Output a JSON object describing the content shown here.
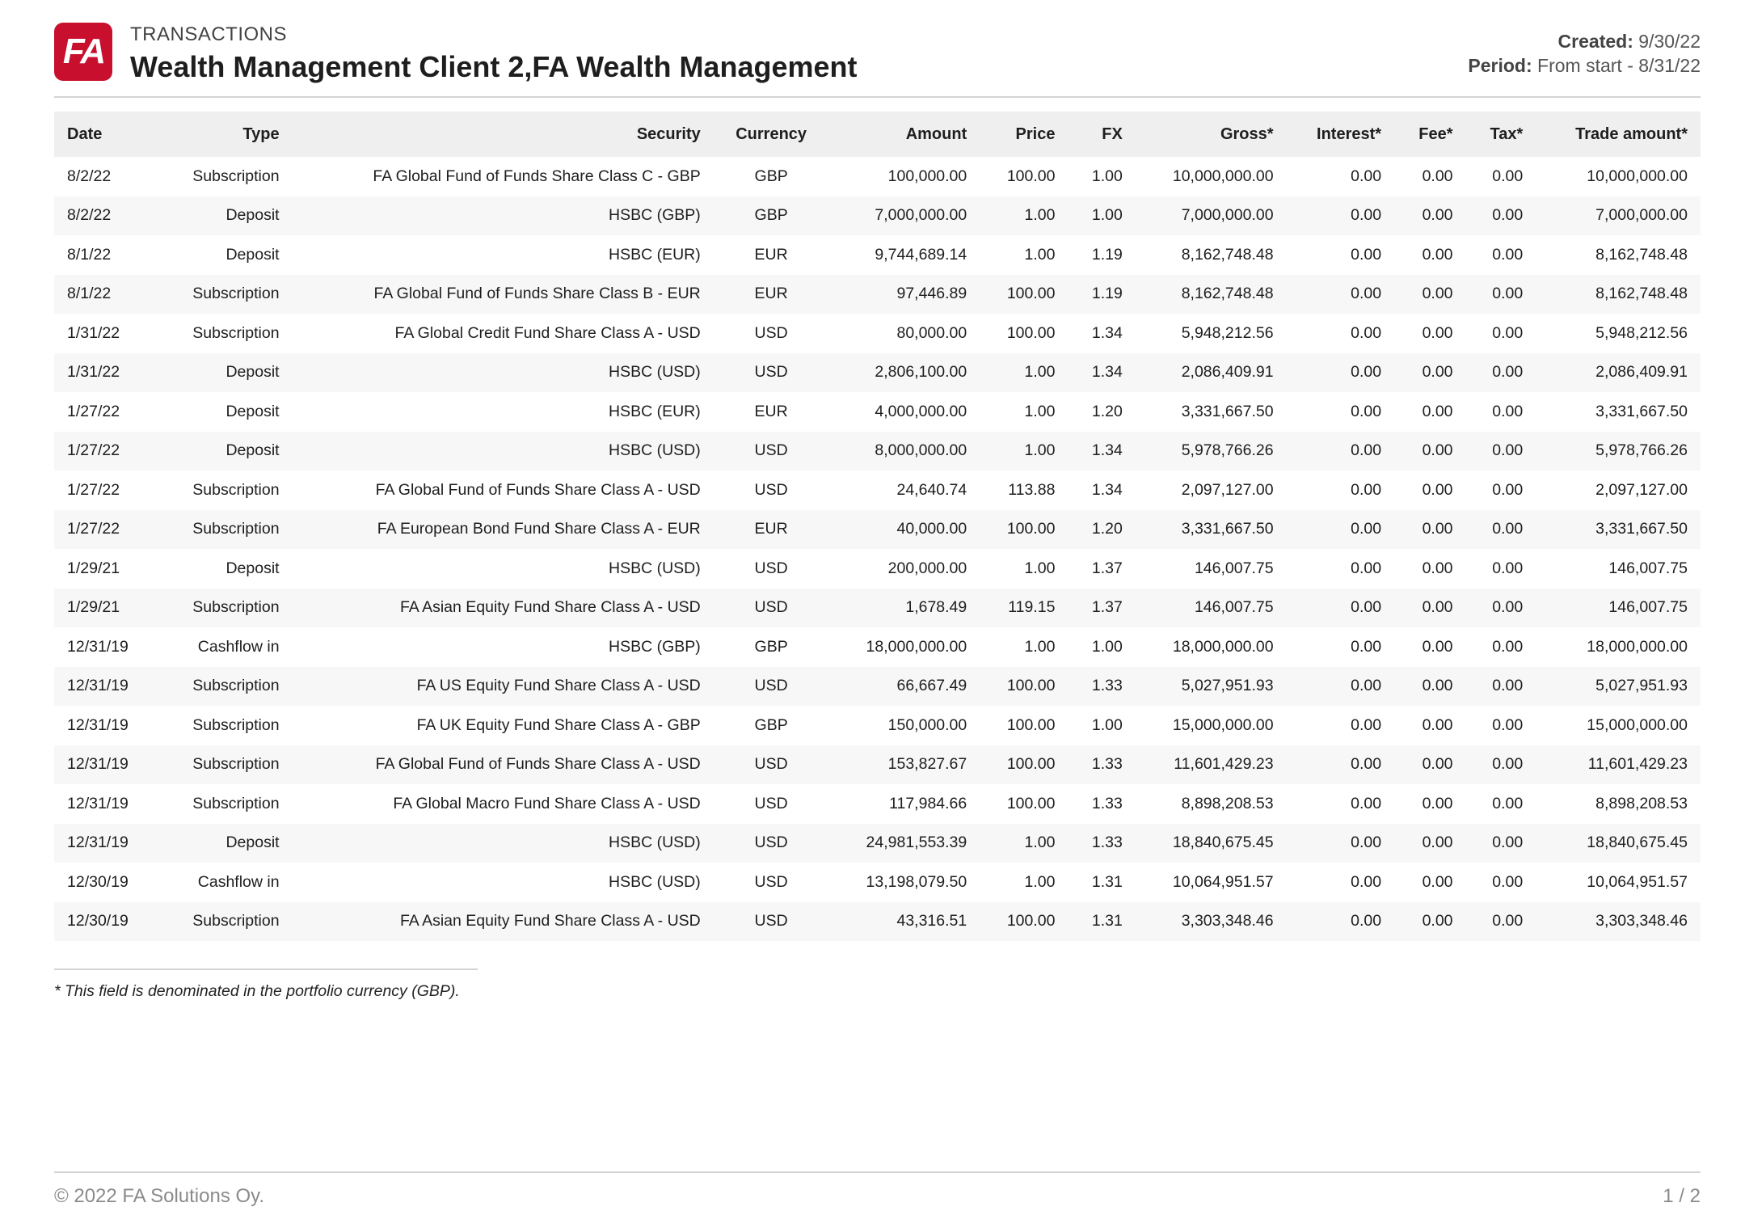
{
  "header": {
    "logo_text": "FA",
    "report_type": "TRANSACTIONS",
    "client_title": "Wealth Management Client 2,FA Wealth Management",
    "created_label": "Created:",
    "created_value": "9/30/22",
    "period_label": "Period:",
    "period_value": "From start - 8/31/22"
  },
  "table": {
    "columns": [
      "Date",
      "Type",
      "Security",
      "Currency",
      "Amount",
      "Price",
      "FX",
      "Gross*",
      "Interest*",
      "Fee*",
      "Tax*",
      "Trade amount*"
    ],
    "rows": [
      [
        "8/2/22",
        "Subscription",
        "FA Global Fund of Funds Share Class C - GBP",
        "GBP",
        "100,000.00",
        "100.00",
        "1.00",
        "10,000,000.00",
        "0.00",
        "0.00",
        "0.00",
        "10,000,000.00"
      ],
      [
        "8/2/22",
        "Deposit",
        "HSBC (GBP)",
        "GBP",
        "7,000,000.00",
        "1.00",
        "1.00",
        "7,000,000.00",
        "0.00",
        "0.00",
        "0.00",
        "7,000,000.00"
      ],
      [
        "8/1/22",
        "Deposit",
        "HSBC (EUR)",
        "EUR",
        "9,744,689.14",
        "1.00",
        "1.19",
        "8,162,748.48",
        "0.00",
        "0.00",
        "0.00",
        "8,162,748.48"
      ],
      [
        "8/1/22",
        "Subscription",
        "FA Global Fund of Funds Share Class B - EUR",
        "EUR",
        "97,446.89",
        "100.00",
        "1.19",
        "8,162,748.48",
        "0.00",
        "0.00",
        "0.00",
        "8,162,748.48"
      ],
      [
        "1/31/22",
        "Subscription",
        "FA Global Credit Fund Share Class A - USD",
        "USD",
        "80,000.00",
        "100.00",
        "1.34",
        "5,948,212.56",
        "0.00",
        "0.00",
        "0.00",
        "5,948,212.56"
      ],
      [
        "1/31/22",
        "Deposit",
        "HSBC (USD)",
        "USD",
        "2,806,100.00",
        "1.00",
        "1.34",
        "2,086,409.91",
        "0.00",
        "0.00",
        "0.00",
        "2,086,409.91"
      ],
      [
        "1/27/22",
        "Deposit",
        "HSBC (EUR)",
        "EUR",
        "4,000,000.00",
        "1.00",
        "1.20",
        "3,331,667.50",
        "0.00",
        "0.00",
        "0.00",
        "3,331,667.50"
      ],
      [
        "1/27/22",
        "Deposit",
        "HSBC (USD)",
        "USD",
        "8,000,000.00",
        "1.00",
        "1.34",
        "5,978,766.26",
        "0.00",
        "0.00",
        "0.00",
        "5,978,766.26"
      ],
      [
        "1/27/22",
        "Subscription",
        "FA Global Fund of Funds Share Class A - USD",
        "USD",
        "24,640.74",
        "113.88",
        "1.34",
        "2,097,127.00",
        "0.00",
        "0.00",
        "0.00",
        "2,097,127.00"
      ],
      [
        "1/27/22",
        "Subscription",
        "FA European Bond Fund Share Class A - EUR",
        "EUR",
        "40,000.00",
        "100.00",
        "1.20",
        "3,331,667.50",
        "0.00",
        "0.00",
        "0.00",
        "3,331,667.50"
      ],
      [
        "1/29/21",
        "Deposit",
        "HSBC (USD)",
        "USD",
        "200,000.00",
        "1.00",
        "1.37",
        "146,007.75",
        "0.00",
        "0.00",
        "0.00",
        "146,007.75"
      ],
      [
        "1/29/21",
        "Subscription",
        "FA Asian Equity Fund Share Class A - USD",
        "USD",
        "1,678.49",
        "119.15",
        "1.37",
        "146,007.75",
        "0.00",
        "0.00",
        "0.00",
        "146,007.75"
      ],
      [
        "12/31/19",
        "Cashflow in",
        "HSBC (GBP)",
        "GBP",
        "18,000,000.00",
        "1.00",
        "1.00",
        "18,000,000.00",
        "0.00",
        "0.00",
        "0.00",
        "18,000,000.00"
      ],
      [
        "12/31/19",
        "Subscription",
        "FA US Equity Fund Share Class A - USD",
        "USD",
        "66,667.49",
        "100.00",
        "1.33",
        "5,027,951.93",
        "0.00",
        "0.00",
        "0.00",
        "5,027,951.93"
      ],
      [
        "12/31/19",
        "Subscription",
        "FA UK Equity Fund Share Class A - GBP",
        "GBP",
        "150,000.00",
        "100.00",
        "1.00",
        "15,000,000.00",
        "0.00",
        "0.00",
        "0.00",
        "15,000,000.00"
      ],
      [
        "12/31/19",
        "Subscription",
        "FA Global Fund of Funds Share Class A - USD",
        "USD",
        "153,827.67",
        "100.00",
        "1.33",
        "11,601,429.23",
        "0.00",
        "0.00",
        "0.00",
        "11,601,429.23"
      ],
      [
        "12/31/19",
        "Subscription",
        "FA Global Macro Fund Share Class A - USD",
        "USD",
        "117,984.66",
        "100.00",
        "1.33",
        "8,898,208.53",
        "0.00",
        "0.00",
        "0.00",
        "8,898,208.53"
      ],
      [
        "12/31/19",
        "Deposit",
        "HSBC (USD)",
        "USD",
        "24,981,553.39",
        "1.00",
        "1.33",
        "18,840,675.45",
        "0.00",
        "0.00",
        "0.00",
        "18,840,675.45"
      ],
      [
        "12/30/19",
        "Cashflow in",
        "HSBC (USD)",
        "USD",
        "13,198,079.50",
        "1.00",
        "1.31",
        "10,064,951.57",
        "0.00",
        "0.00",
        "0.00",
        "10,064,951.57"
      ],
      [
        "12/30/19",
        "Subscription",
        "FA Asian Equity Fund Share Class A - USD",
        "USD",
        "43,316.51",
        "100.00",
        "1.31",
        "3,303,348.46",
        "0.00",
        "0.00",
        "0.00",
        "3,303,348.46"
      ]
    ]
  },
  "footnote": "* This field is denominated in the portfolio currency (GBP).",
  "footer": {
    "copyright": "© 2022 FA Solutions Oy.",
    "page": "1 / 2"
  }
}
